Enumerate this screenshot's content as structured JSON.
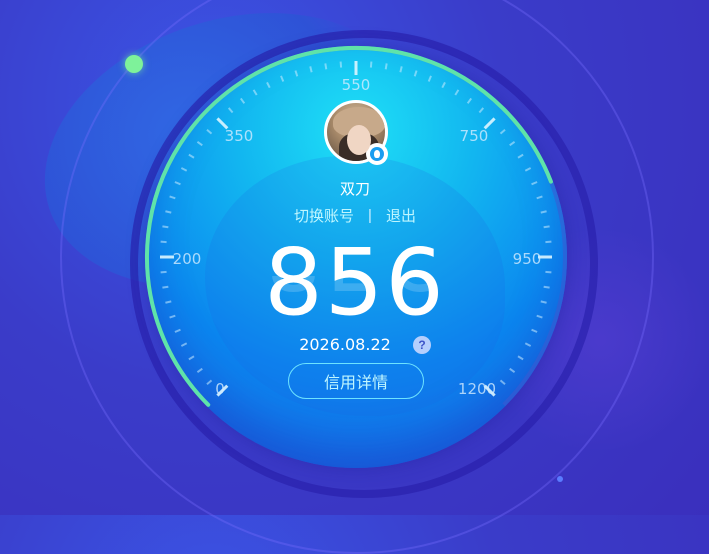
{
  "gauge": {
    "scale_labels": [
      "0",
      "200",
      "350",
      "550",
      "750",
      "950",
      "1200"
    ],
    "score": "856",
    "date": "2026.08.22"
  },
  "user": {
    "name": "双刀",
    "switch_account": "切换账号",
    "separator": "|",
    "logout": "退出",
    "avatar_icon": "user-avatar",
    "badge_icon": "qq-penguin-icon"
  },
  "actions": {
    "help": "?",
    "details": "信用详情"
  },
  "colors": {
    "progress_arc": "#5fe3a9",
    "accent": "#6de3ff",
    "dial_center": "#12b6f0"
  }
}
